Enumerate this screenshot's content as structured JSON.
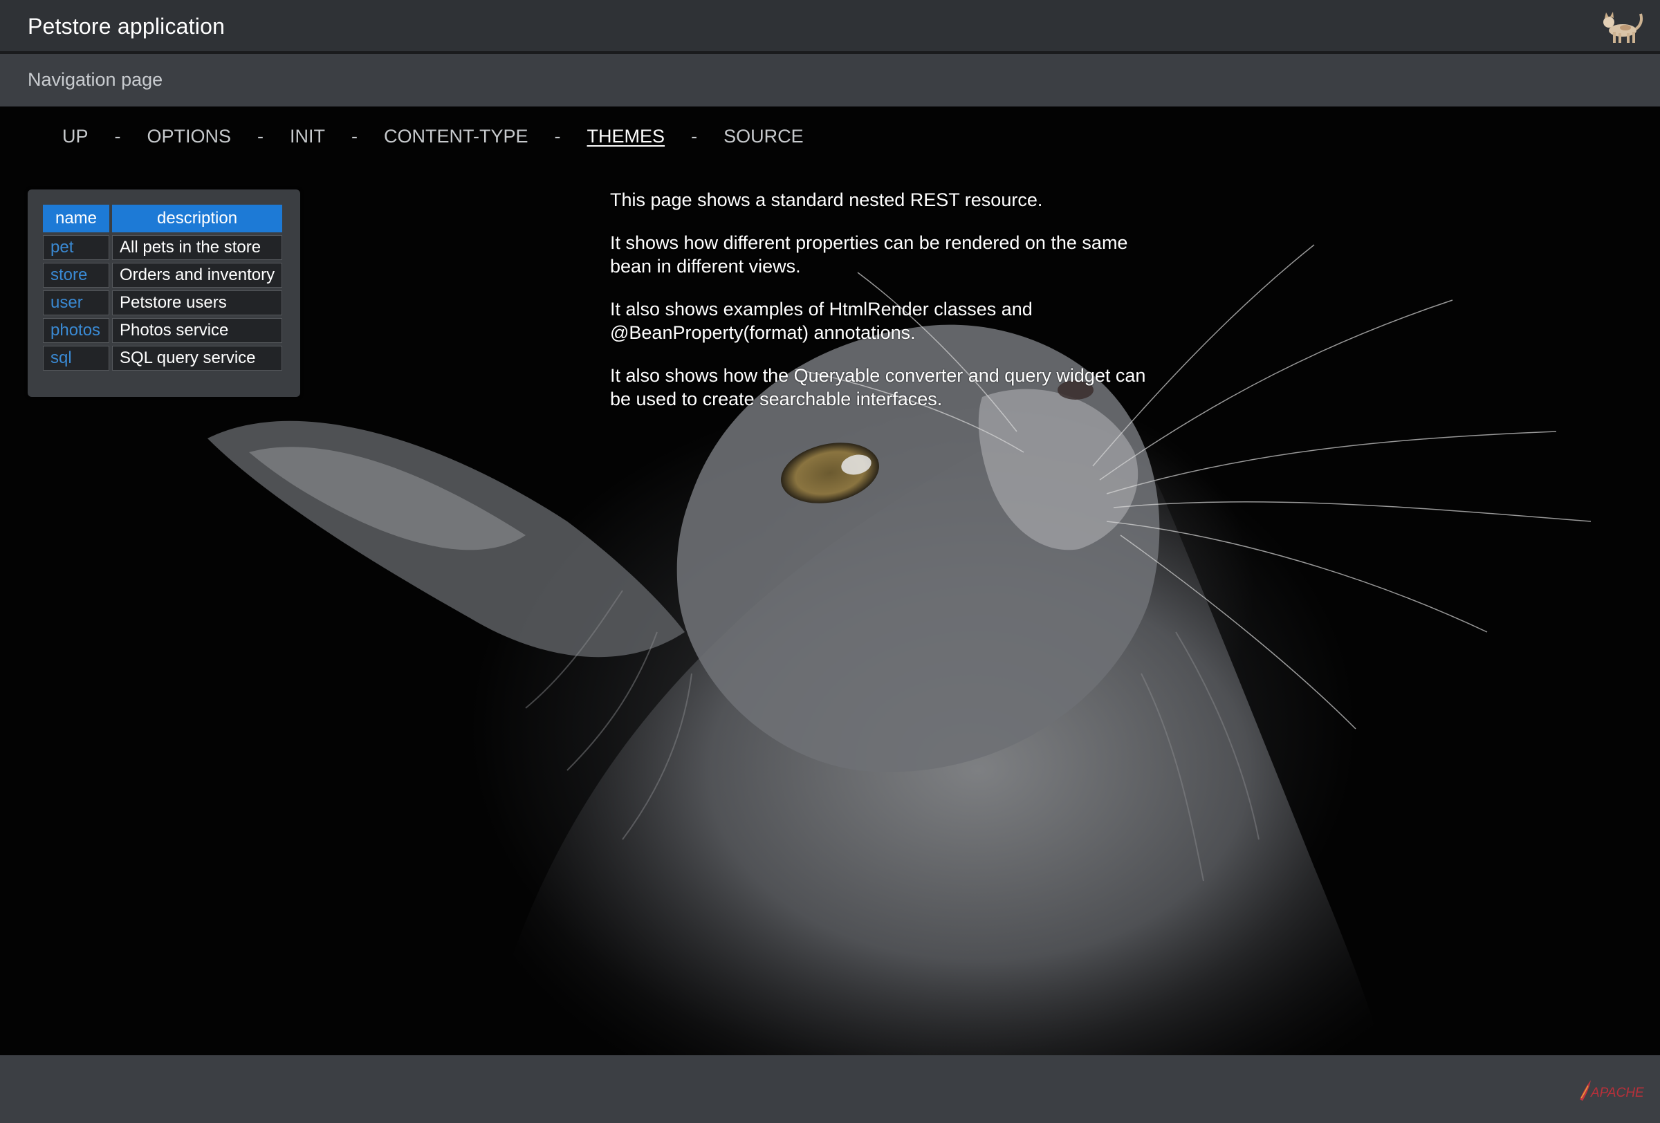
{
  "header": {
    "title": "Petstore application",
    "logo_icon": "cat-icon"
  },
  "nav_header": {
    "title": "Navigation page"
  },
  "nav_links": [
    {
      "label": "UP",
      "active": false
    },
    {
      "label": "OPTIONS",
      "active": false
    },
    {
      "label": "INIT",
      "active": false
    },
    {
      "label": "CONTENT-TYPE",
      "active": false
    },
    {
      "label": "THEMES",
      "active": true
    },
    {
      "label": "SOURCE",
      "active": false
    }
  ],
  "nav_separator": "-",
  "table": {
    "headers": {
      "name": "name",
      "description": "description"
    },
    "rows": [
      {
        "name": "pet",
        "description": "All pets in the store"
      },
      {
        "name": "store",
        "description": "Orders and inventory"
      },
      {
        "name": "user",
        "description": "Petstore users"
      },
      {
        "name": "photos",
        "description": "Photos service"
      },
      {
        "name": "sql",
        "description": "SQL query service"
      }
    ]
  },
  "description": {
    "p1": "This page shows a standard nested REST resource.",
    "p2": "It shows how different properties can be rendered on the same bean in different views.",
    "p3": "It also shows examples of HtmlRender classes and @BeanProperty(format) annotations.",
    "p4": "It also shows how the Queryable converter and query widget can be used to create searchable interfaces."
  },
  "footer": {
    "logo_text": "APACHE",
    "logo_icon": "apache-feather-icon"
  },
  "colors": {
    "header_bg": "#2f3236",
    "subheader_bg": "#3c3f44",
    "table_header_bg": "#1d7ad6",
    "link_color": "#3a8ad4",
    "active_link": "#ffffff"
  }
}
